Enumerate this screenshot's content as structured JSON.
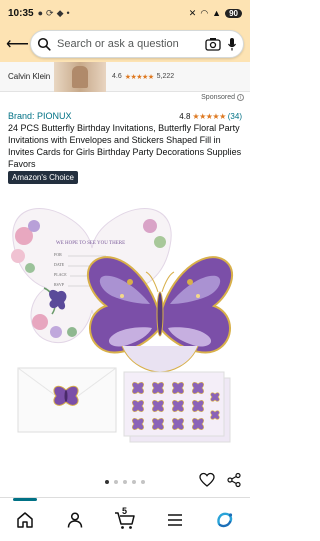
{
  "status_bar": {
    "time": "10:35",
    "battery": "90"
  },
  "search": {
    "placeholder": "Search or ask a question"
  },
  "ad": {
    "brand": "Calvin Klein",
    "rating": "4.6",
    "stars": "★★★★★",
    "count": "5,222",
    "sponsored_label": "Sponsored"
  },
  "product": {
    "brand": "Brand: PIONUX",
    "rating": "4.8",
    "stars": "★★★★★",
    "review_count": "(34)",
    "title": "24 PCS Butterfly Birthday Invitations, Butterfly Floral Party Invitations with Envelopes and Stickers Shaped Fill in Invites Cards for Girls Birthday Party Decorations Supplies Favors",
    "badge": "Amazon's Choice",
    "card_text": {
      "heading": "WE HOPE TO SEE YOU THERE",
      "for": "FOR",
      "date": "DATE",
      "place": "PLACE",
      "rsvp": "RSVP"
    }
  },
  "carousel": {
    "total": 5,
    "active_index": 0
  },
  "colors": {
    "header_bg": "#fde3b3",
    "link": "#007185",
    "star": "#de7921",
    "badge_bg": "#232f3e",
    "butterfly_purple": "#7b4fa8",
    "butterfly_gold": "#d8b04a"
  },
  "nav": {
    "cart_count": "5",
    "items": [
      "home-icon",
      "account-icon",
      "cart-icon",
      "menu-icon",
      "rufus-icon"
    ]
  }
}
